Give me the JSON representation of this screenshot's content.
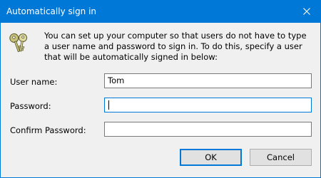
{
  "dialog": {
    "title": "Automatically sign in",
    "description": "You can set up your computer so that users do not have to type a user name and password to sign in. To do this, specify a user that will be automatically signed in below:",
    "icon": "keys-icon"
  },
  "fields": {
    "username": {
      "label": "User name:",
      "value": "Tom"
    },
    "password": {
      "label": "Password:",
      "value": ""
    },
    "confirm_password": {
      "label": "Confirm Password:",
      "value": ""
    }
  },
  "buttons": {
    "ok": "OK",
    "cancel": "Cancel"
  },
  "colors": {
    "accent": "#0078d7",
    "dialog_background": "#f0f0f0",
    "button_face": "#e1e1e1"
  }
}
